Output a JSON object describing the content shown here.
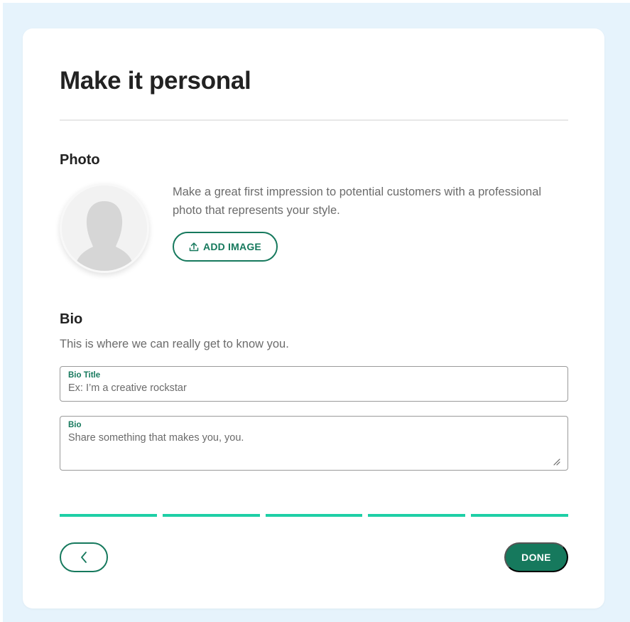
{
  "page": {
    "title": "Make it personal"
  },
  "photo": {
    "heading": "Photo",
    "description": "Make a great first impression to potential customers with a professional photo that represents your style.",
    "add_image_label": "ADD IMAGE",
    "avatar_icon": "person-silhouette-icon"
  },
  "bio": {
    "heading": "Bio",
    "description": "This is where we can really get to know you.",
    "title_field": {
      "label": "Bio Title",
      "placeholder": "Ex: I’m a creative rockstar",
      "value": ""
    },
    "bio_field": {
      "label": "Bio",
      "placeholder": "Share something that makes you, you.",
      "value": ""
    }
  },
  "progress": {
    "steps_total": 5,
    "steps_completed": 5
  },
  "footer": {
    "back_icon": "chevron-left-icon",
    "done_label": "DONE"
  },
  "colors": {
    "accent": "#16795d",
    "progress": "#1ecfa6",
    "backdrop": "#e6f3fc"
  }
}
